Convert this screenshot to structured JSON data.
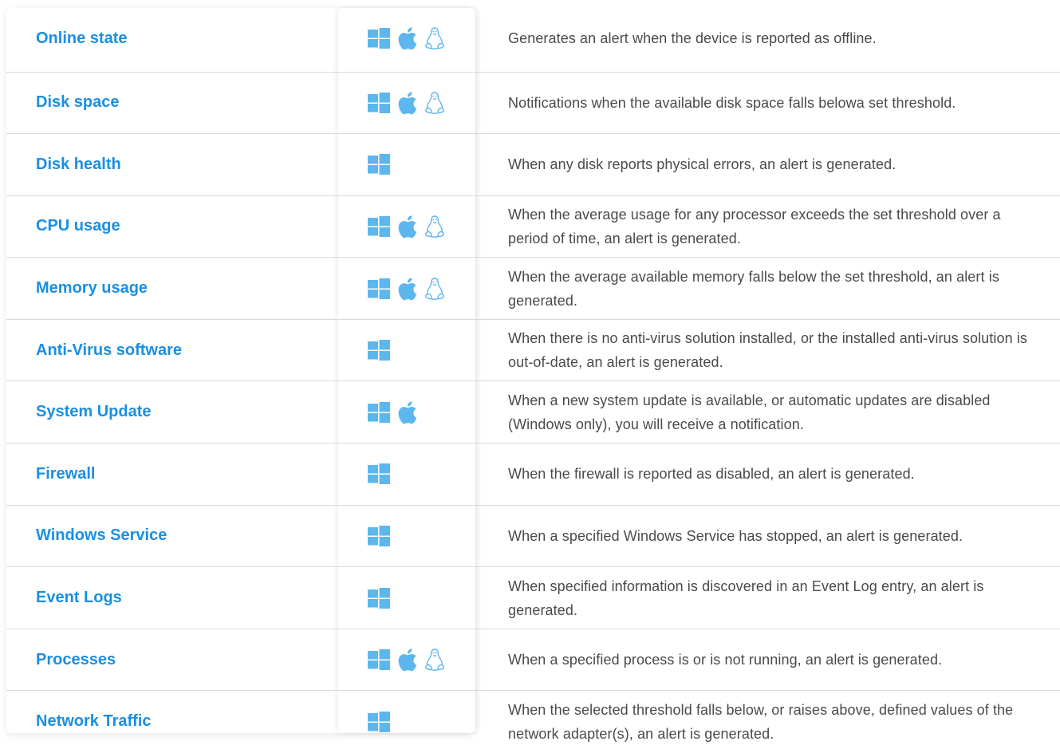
{
  "colors": {
    "name": "#1a8fe3",
    "icon": "#5db7ef",
    "text": "#4a4a4a",
    "divider": "#d9d9d9"
  },
  "rows": [
    {
      "name": "Online state",
      "os": [
        "windows-icon",
        "apple-icon",
        "linux-icon"
      ],
      "desc": "Generates an alert when the device is reported as offline."
    },
    {
      "name": "Disk space",
      "os": [
        "windows-icon",
        "apple-icon",
        "linux-icon"
      ],
      "desc": "Notifications when the available disk space falls belowa set threshold."
    },
    {
      "name": "Disk health",
      "os": [
        "windows-icon"
      ],
      "desc": "When any disk reports physical errors, an alert is generated."
    },
    {
      "name": "CPU usage",
      "os": [
        "windows-icon",
        "apple-icon",
        "linux-icon"
      ],
      "desc": "When the average usage for any processor exceeds the set threshold over a period of time, an alert is generated."
    },
    {
      "name": "Memory usage",
      "os": [
        "windows-icon",
        "apple-icon",
        "linux-icon"
      ],
      "desc": "When the average available memory falls below the set threshold, an alert is generated."
    },
    {
      "name": "Anti-Virus software",
      "os": [
        "windows-icon"
      ],
      "desc": "When there is no anti-virus solution installed, or the installed anti-virus solution is out-of-date, an alert is generated."
    },
    {
      "name": "System Update",
      "os": [
        "windows-icon",
        "apple-icon"
      ],
      "desc": "When a new system update is available, or automatic updates are disabled (Windows only), you will receive a notification."
    },
    {
      "name": "Firewall",
      "os": [
        "windows-icon"
      ],
      "desc": "When the firewall is reported as disabled, an alert is generated."
    },
    {
      "name": "Windows Service",
      "os": [
        "windows-icon"
      ],
      "desc": "When a specified Windows Service has stopped, an alert is generated."
    },
    {
      "name": "Event Logs",
      "os": [
        "windows-icon"
      ],
      "desc": "When specified information is discovered in an Event Log entry, an alert is generated."
    },
    {
      "name": "Processes",
      "os": [
        "windows-icon",
        "apple-icon",
        "linux-icon"
      ],
      "desc": "When a specified process is or is not running, an alert is generated."
    },
    {
      "name": "Network Traffic",
      "os": [
        "windows-icon"
      ],
      "desc": "When the selected threshold falls below, or raises above, defined values of the network adapter(s), an alert is generated."
    }
  ]
}
